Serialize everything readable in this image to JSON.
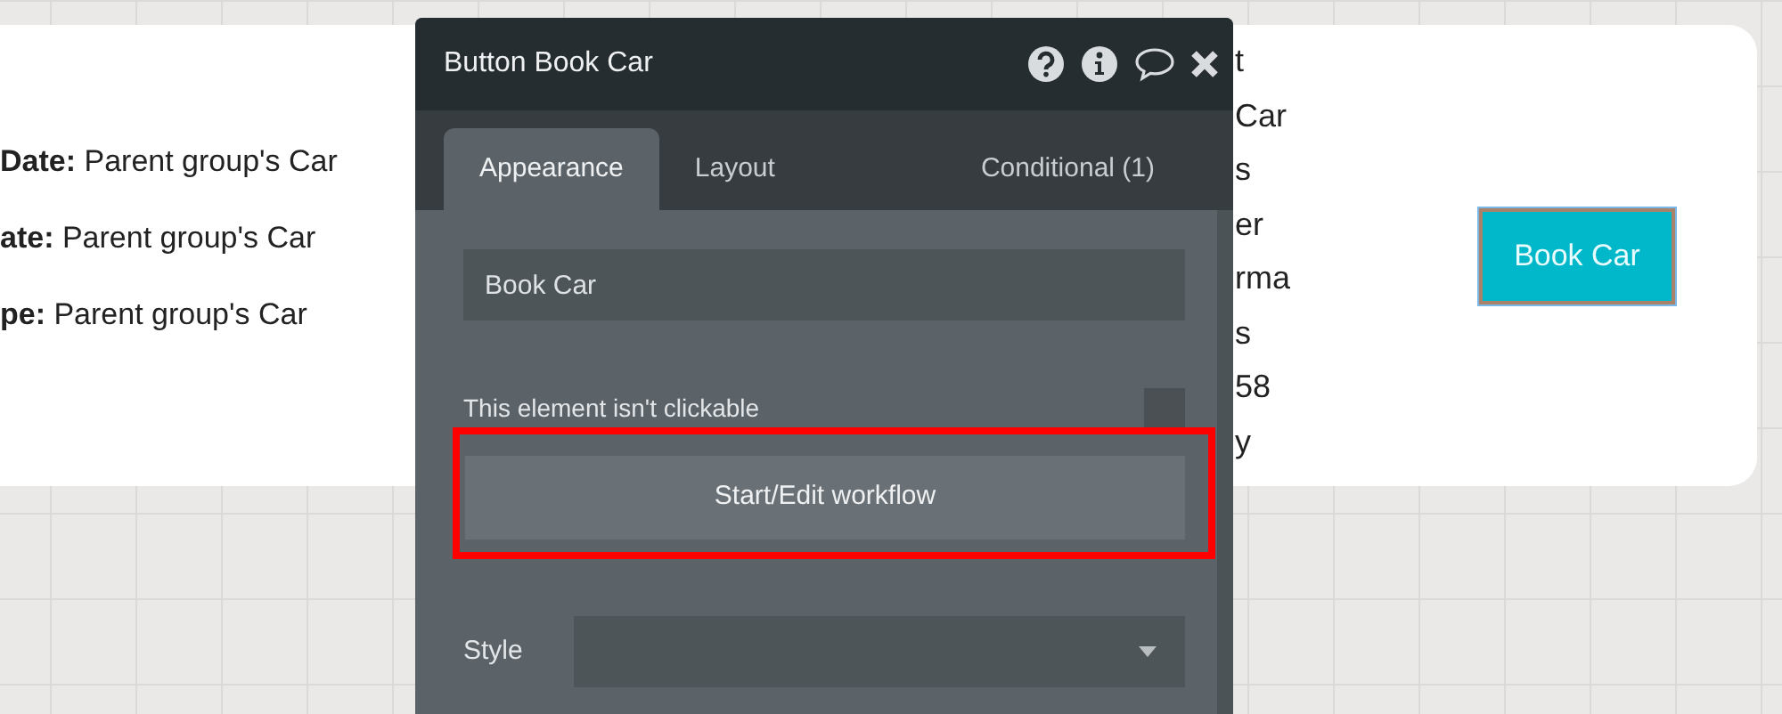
{
  "card": {
    "fields": [
      "**Date:** Parent group's Car",
      "**ate:** Parent group's Car",
      "**pe:** Parent group's Car"
    ],
    "fragments": [
      "t",
      "Car",
      "s",
      "er",
      "rma",
      "s",
      "58",
      "y"
    ],
    "button": "Book Car"
  },
  "panel": {
    "title": "Button Book Car",
    "tabs": [
      {
        "label": "Appearance",
        "selected": true
      },
      {
        "label": "Layout",
        "selected": false
      },
      {
        "label": "Conditional (1)",
        "selected": false
      }
    ],
    "text_value": "Book Car",
    "clickable": {
      "label": "This element isn't clickable",
      "checked": false
    },
    "workflow_button": {
      "label": "Start/Edit workflow",
      "highlighted": true
    },
    "style": {
      "label": "Style"
    }
  }
}
